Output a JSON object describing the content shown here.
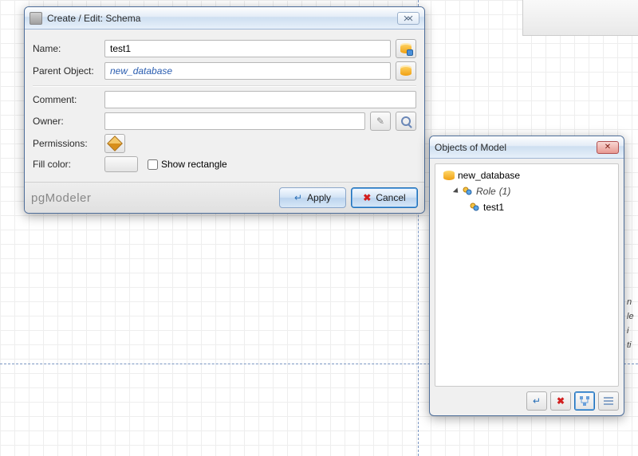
{
  "dialog": {
    "title": "Create / Edit: Schema",
    "fields": {
      "name_label": "Name:",
      "name_value": "test1",
      "parent_label": "Parent Object:",
      "parent_value": "new_database",
      "comment_label": "Comment:",
      "comment_value": "",
      "owner_label": "Owner:",
      "owner_value": "",
      "permissions_label": "Permissions:",
      "fillcolor_label": "Fill color:",
      "show_rect_label": "Show rectangle"
    },
    "brand": "pgModeler",
    "apply": "Apply",
    "cancel": "Cancel"
  },
  "panel": {
    "title": "Objects of Model",
    "tree": {
      "db": "new_database",
      "role_label": "Role",
      "role_count": "(1)",
      "role_item": "test1"
    }
  }
}
